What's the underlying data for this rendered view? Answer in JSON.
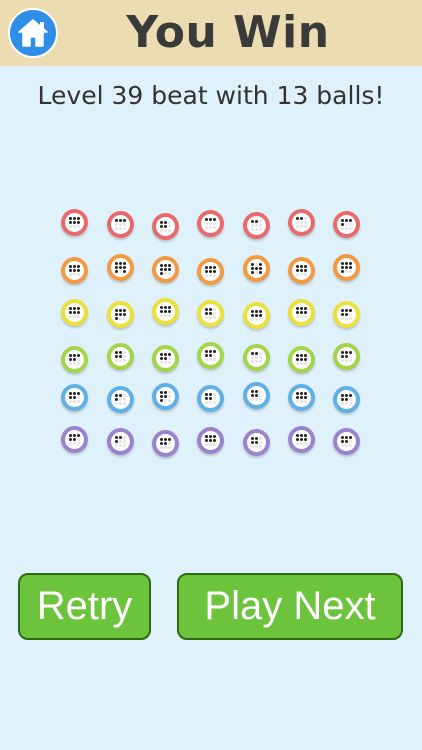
{
  "header": {
    "title": "You Win",
    "home_icon": "home-icon"
  },
  "subtitle": "Level 39 beat with 13 balls!",
  "balls": {
    "rows": [
      {
        "color": "#e86a6c",
        "dots": [
          [
            1,
            1,
            1,
            1,
            1,
            1,
            0,
            0,
            0
          ],
          [
            1,
            1,
            1,
            0,
            0,
            0,
            0,
            0,
            0
          ],
          [
            1,
            1,
            0,
            1,
            1,
            0,
            0,
            0,
            0
          ],
          [
            1,
            1,
            1,
            0,
            0,
            0,
            0,
            0,
            0
          ],
          [
            1,
            1,
            0,
            0,
            0,
            0,
            0,
            0,
            0
          ],
          [
            1,
            1,
            0,
            0,
            0,
            0,
            0,
            0,
            0
          ],
          [
            1,
            1,
            1,
            1,
            0,
            0,
            0,
            0,
            0
          ]
        ]
      },
      {
        "color": "#f19a42",
        "dots": [
          [
            1,
            1,
            1,
            1,
            1,
            1,
            0,
            0,
            0
          ],
          [
            1,
            1,
            1,
            1,
            1,
            1,
            1,
            0,
            1
          ],
          [
            1,
            1,
            1,
            1,
            1,
            1,
            1,
            0,
            0
          ],
          [
            1,
            1,
            1,
            1,
            1,
            1,
            0,
            0,
            0
          ],
          [
            1,
            0,
            1,
            1,
            1,
            1,
            1,
            0,
            1
          ],
          [
            1,
            1,
            1,
            1,
            1,
            1,
            0,
            0,
            0
          ],
          [
            1,
            1,
            1,
            1,
            1,
            1,
            1,
            0,
            0
          ]
        ]
      },
      {
        "color": "#eee03a",
        "dots": [
          [
            1,
            1,
            1,
            1,
            1,
            1,
            0,
            0,
            0
          ],
          [
            1,
            1,
            1,
            1,
            1,
            1,
            1,
            0,
            0
          ],
          [
            1,
            1,
            1,
            1,
            1,
            1,
            0,
            0,
            0
          ],
          [
            1,
            1,
            0,
            1,
            1,
            0,
            0,
            0,
            0
          ],
          [
            1,
            1,
            1,
            1,
            1,
            1,
            0,
            0,
            0
          ],
          [
            1,
            1,
            1,
            1,
            1,
            1,
            0,
            0,
            0
          ],
          [
            1,
            1,
            1,
            1,
            1,
            0,
            0,
            0,
            0
          ]
        ]
      },
      {
        "color": "#a2d548",
        "dots": [
          [
            1,
            1,
            1,
            1,
            1,
            0,
            0,
            0,
            0
          ],
          [
            1,
            1,
            0,
            1,
            1,
            0,
            0,
            0,
            0
          ],
          [
            1,
            1,
            1,
            1,
            1,
            0,
            0,
            0,
            0
          ],
          [
            1,
            1,
            1,
            1,
            1,
            0,
            0,
            0,
            0
          ],
          [
            1,
            1,
            0,
            0,
            0,
            0,
            0,
            0,
            0
          ],
          [
            1,
            1,
            1,
            1,
            1,
            1,
            0,
            0,
            0
          ],
          [
            1,
            1,
            1,
            1,
            1,
            0,
            0,
            0,
            0
          ]
        ]
      },
      {
        "color": "#5fb0e4",
        "dots": [
          [
            1,
            1,
            1,
            1,
            1,
            0,
            0,
            0,
            0
          ],
          [
            1,
            1,
            0,
            1,
            0,
            0,
            0,
            0,
            0
          ],
          [
            1,
            1,
            0,
            1,
            1,
            0,
            1,
            0,
            0
          ],
          [
            1,
            1,
            0,
            1,
            1,
            0,
            0,
            0,
            0
          ],
          [
            1,
            1,
            0,
            1,
            1,
            0,
            0,
            0,
            0
          ],
          [
            1,
            1,
            1,
            1,
            1,
            1,
            0,
            0,
            0
          ],
          [
            1,
            1,
            1,
            1,
            1,
            0,
            0,
            0,
            0
          ]
        ]
      },
      {
        "color": "#9a83cd",
        "dots": [
          [
            1,
            1,
            1,
            1,
            1,
            0,
            0,
            0,
            0
          ],
          [
            1,
            1,
            0,
            1,
            0,
            0,
            0,
            0,
            0
          ],
          [
            1,
            1,
            1,
            1,
            1,
            0,
            0,
            0,
            0
          ],
          [
            1,
            1,
            1,
            1,
            1,
            1,
            0,
            0,
            0
          ],
          [
            1,
            1,
            0,
            1,
            1,
            0,
            0,
            0,
            0
          ],
          [
            1,
            1,
            1,
            1,
            1,
            1,
            0,
            0,
            0
          ],
          [
            1,
            1,
            1,
            1,
            1,
            0,
            0,
            0,
            0
          ]
        ]
      }
    ]
  },
  "buttons": {
    "retry_label": "Retry",
    "next_label": "Play Next"
  }
}
